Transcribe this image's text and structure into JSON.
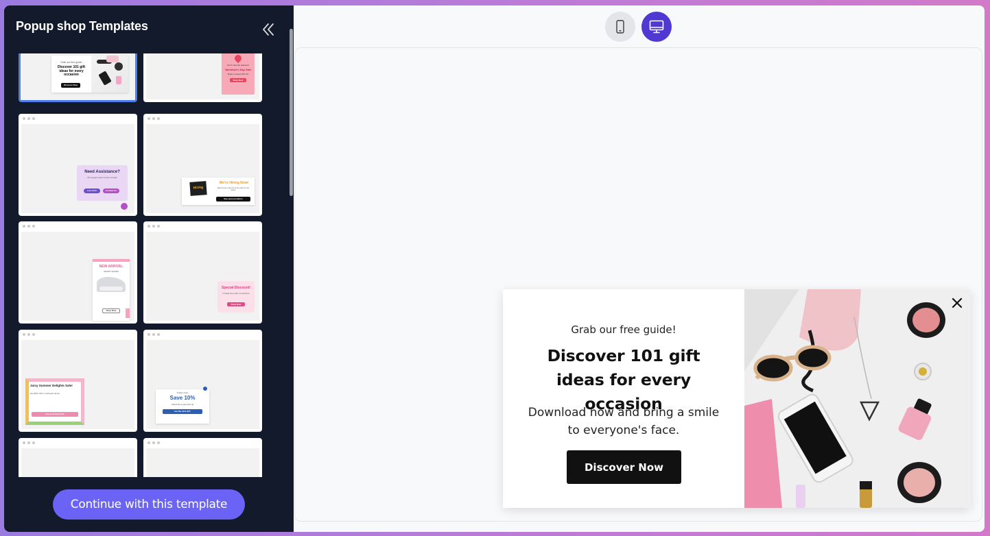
{
  "sidebar": {
    "title": "Popup shop Templates",
    "continue_label": "Continue with this template"
  },
  "templates": [
    {
      "selected": true,
      "eyebrow": "Grab our free guide!",
      "title": "Discover 101 gift ideas for every occasion",
      "cta": "Discover Now"
    },
    {
      "selected": false,
      "eyebrow": "Don't miss the sweetest",
      "title": "Valentine's Day Sale",
      "body": "Enjoy a sweet 15% off",
      "cta": "Shop Now"
    },
    {
      "selected": false,
      "title": "Need Assistance?",
      "body": "Our support team is here to help!",
      "cta1": "Live Chat",
      "cta2": "Contact Us"
    },
    {
      "selected": false,
      "badge": "Hiring",
      "title": "We're Hiring Now!",
      "body": "Send your resume to be part of our team",
      "cta": "See open positions"
    },
    {
      "selected": false,
      "title": "NEW ARRIVAL",
      "subtitle": "SPORT SHOES",
      "cta": "Shop Now"
    },
    {
      "selected": false,
      "title": "Special Discount!",
      "body": "Limited time offer on all items",
      "cta": "Shop Now"
    },
    {
      "selected": false,
      "title": "Juicy Summer Delights Sale!",
      "body": "Get 50% OFF on all fresh drinks",
      "cta": "Get your Save 50%"
    },
    {
      "selected": false,
      "eyebrow": "3 Days Only!",
      "title": "Save 10%",
      "body": "Subscribe & get 10% off",
      "cta": "Get My 10% OFF"
    },
    {
      "selected": false
    },
    {
      "selected": false
    }
  ],
  "toolbar": {
    "mobile_icon": "mobile-phone-icon",
    "desktop_icon": "desktop-monitor-icon",
    "active_color": "#4f39d2"
  },
  "popup": {
    "eyebrow": "Grab our free guide!",
    "heading": "Discover 101 gift ideas for every occasion",
    "body": "Download now and bring a smile to everyone's face.",
    "cta": "Discover Now",
    "close_icon": "close-icon"
  }
}
